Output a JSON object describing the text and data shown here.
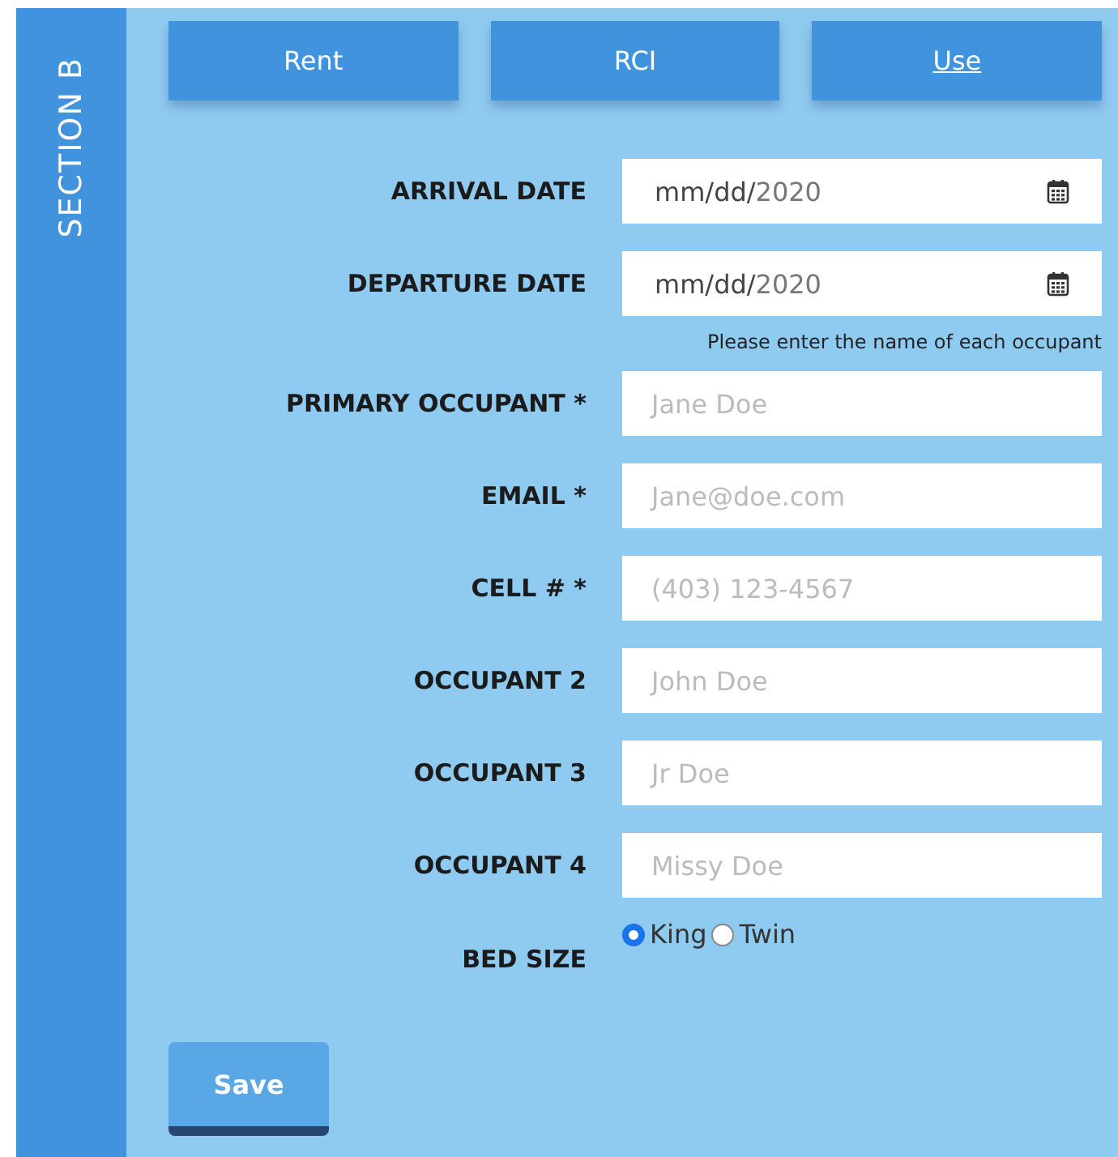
{
  "sidebar": {
    "title": "SECTION B"
  },
  "tabs": [
    {
      "label": "Rent",
      "selected": false
    },
    {
      "label": "RCI",
      "selected": false
    },
    {
      "label": "Use",
      "selected": true
    }
  ],
  "date_fields": [
    {
      "label": "ARRIVAL DATE",
      "value_mask": "mm/dd/",
      "value_year": "2020"
    },
    {
      "label": "DEPARTURE DATE",
      "value_mask": "mm/dd/",
      "value_year": "2020"
    }
  ],
  "hint": "Please enter the name of each occupant",
  "fields": [
    {
      "label": "PRIMARY OCCUPANT *",
      "placeholder": "Jane Doe"
    },
    {
      "label": "EMAIL *",
      "placeholder": "Jane@doe.com"
    },
    {
      "label": "CELL # *",
      "placeholder": "(403) 123-4567"
    },
    {
      "label": "OCCUPANT 2",
      "placeholder": "John Doe"
    },
    {
      "label": "OCCUPANT 3",
      "placeholder": "Jr Doe"
    },
    {
      "label": "OCCUPANT 4",
      "placeholder": "Missy Doe"
    }
  ],
  "bed_size": {
    "label": "BED SIZE",
    "options": [
      {
        "label": "King",
        "selected": true
      },
      {
        "label": "Twin",
        "selected": false
      }
    ]
  },
  "save_button": "Save"
}
